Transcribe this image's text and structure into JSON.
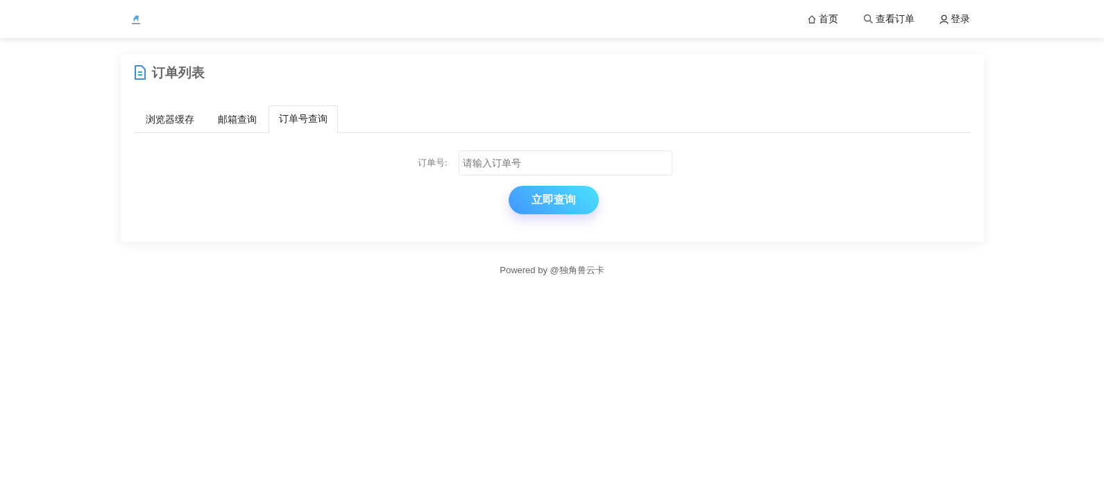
{
  "nav": [
    {
      "kind": "home",
      "label": "首页"
    },
    {
      "kind": "search",
      "label": "查看订单"
    },
    {
      "kind": "user",
      "label": "登录"
    }
  ],
  "card": {
    "title": "订单列表",
    "tabs": [
      {
        "label": "浏览器缓存",
        "selected": false
      },
      {
        "label": "邮箱查询",
        "selected": false
      },
      {
        "label": "订单号查询",
        "selected": true
      }
    ],
    "field": {
      "label": "订单号:",
      "placeholder": "请输入订单号"
    },
    "button": "立即查询"
  },
  "footer": "Powered by @独角兽云卡"
}
